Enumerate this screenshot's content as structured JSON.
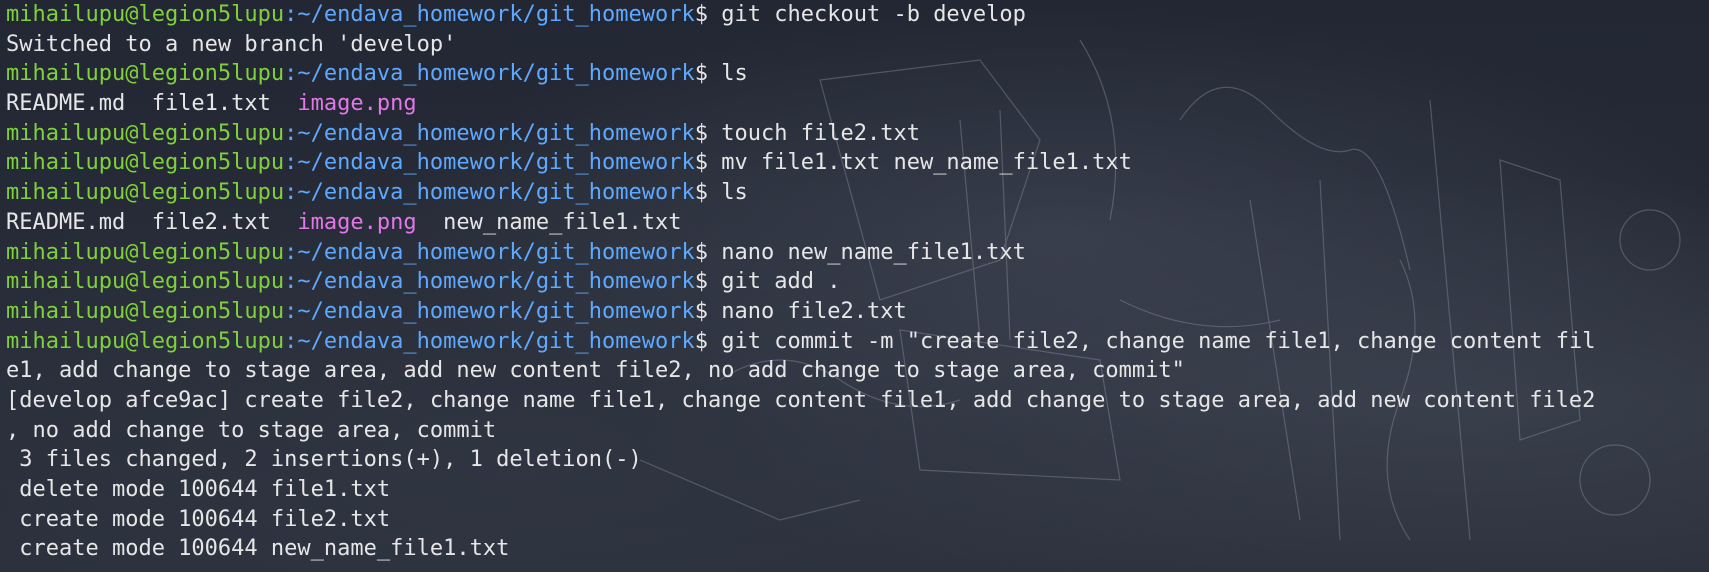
{
  "prompt": {
    "user_host": "mihailupu@legion5lupu",
    "path": ":~/endava_homework/git_homework",
    "dollar": "$ "
  },
  "lines": [
    {
      "type": "cmd",
      "text": "git checkout -b develop"
    },
    {
      "type": "out",
      "text": "Switched to a new branch 'develop'"
    },
    {
      "type": "cmd",
      "text": "ls"
    },
    {
      "type": "ls",
      "parts": [
        {
          "t": "README.md  file1.txt  ",
          "c": "plain"
        },
        {
          "t": "image.png",
          "c": "img"
        }
      ]
    },
    {
      "type": "cmd",
      "text": "touch file2.txt"
    },
    {
      "type": "cmd",
      "text": "mv file1.txt new_name_file1.txt"
    },
    {
      "type": "cmd",
      "text": "ls"
    },
    {
      "type": "ls",
      "parts": [
        {
          "t": "README.md  file2.txt  ",
          "c": "plain"
        },
        {
          "t": "image.png",
          "c": "img"
        },
        {
          "t": "  new_name_file1.txt",
          "c": "plain"
        }
      ]
    },
    {
      "type": "cmd",
      "text": "nano new_name_file1.txt"
    },
    {
      "type": "cmd",
      "text": "git add ."
    },
    {
      "type": "cmd",
      "text": "nano file2.txt"
    },
    {
      "type": "cmd",
      "text": "git commit -m \"create file2, change name file1, change content fil"
    },
    {
      "type": "out",
      "text": "e1, add change to stage area, add new content file2, no add change to stage area, commit\""
    },
    {
      "type": "out",
      "text": "[develop afce9ac] create file2, change name file1, change content file1, add change to stage area, add new content file2"
    },
    {
      "type": "out",
      "text": ", no add change to stage area, commit"
    },
    {
      "type": "out",
      "text": " 3 files changed, 2 insertions(+), 1 deletion(-)"
    },
    {
      "type": "out",
      "text": " delete mode 100644 file1.txt"
    },
    {
      "type": "out",
      "text": " create mode 100644 file2.txt"
    },
    {
      "type": "out",
      "text": " create mode 100644 new_name_file1.txt"
    }
  ]
}
